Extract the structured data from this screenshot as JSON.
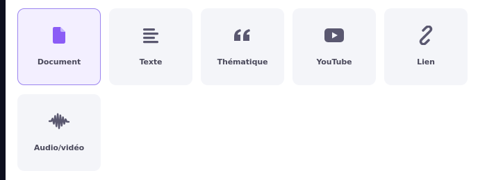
{
  "colors": {
    "accent": "#8b5cf6",
    "icon": "#5a5870",
    "tile_bg": "#f4f5f9",
    "selected_bg": "#f3efff",
    "selected_border": "#9b84ef"
  },
  "source_types": [
    {
      "label": "Document",
      "icon": "document-icon",
      "selected": true
    },
    {
      "label": "Texte",
      "icon": "text-lines-icon",
      "selected": false
    },
    {
      "label": "Thématique",
      "icon": "quote-icon",
      "selected": false
    },
    {
      "label": "YouTube",
      "icon": "youtube-icon",
      "selected": false
    },
    {
      "label": "Lien",
      "icon": "link-icon",
      "selected": false
    },
    {
      "label": "Audio/vidéo",
      "icon": "waveform-icon",
      "selected": false
    }
  ]
}
